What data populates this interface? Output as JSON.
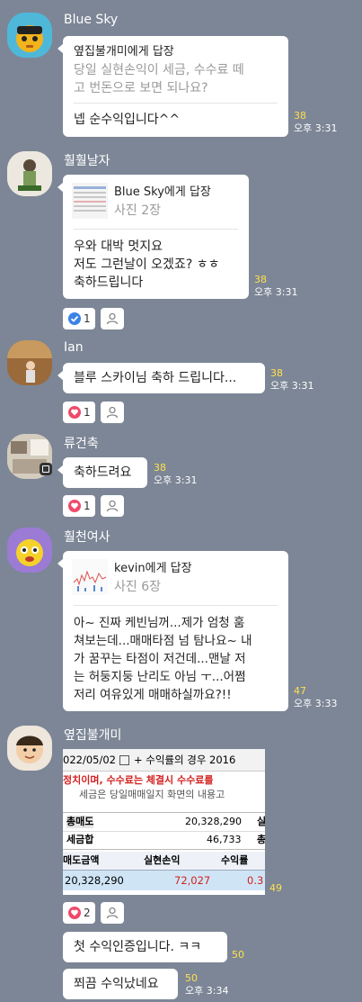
{
  "colors": {
    "background": "#7c8696",
    "bubble": "#ffffff",
    "unread": "#ffe14d"
  },
  "messages": [
    {
      "sender": "Blue Sky",
      "reply_to": "옆집불개미에게 답장",
      "quoted_line1": "당일 실현손익이 세금, 수수료 떼",
      "quoted_line2": "고 번돈으로 보면 되나요?",
      "text": "넵 순수익입니다^^",
      "unread": "38",
      "time": "오후 3:31"
    },
    {
      "sender": "훨훨날자",
      "reply_to": "Blue Sky에게 답장",
      "quoted": "사진 2장",
      "line1": "우와 대박 멋지요",
      "line2": "저도 그런날이 오겠죠? ㅎㅎ",
      "line3": "축하드립니다",
      "unread": "38",
      "time": "오후 3:31",
      "reaction_count": "1"
    },
    {
      "sender": "Ian",
      "text": "블루 스카이님 축하 드립니다...",
      "unread": "38",
      "time": "오후 3:31",
      "reaction_count": "1"
    },
    {
      "sender": "류건축",
      "text": "축하드려요",
      "unread": "38",
      "time": "오후 3:31",
      "reaction_count": "1"
    },
    {
      "sender": "훨천여사",
      "reply_to": "kevin에게 답장",
      "quoted": "사진 6장",
      "line1": "아~ 진짜 케빈님꺼...제가 엄청 훔",
      "line2": "쳐보는데...매매타점 넘 탐나요~ 내",
      "line3": "가 꿈꾸는 타점이 저건데...맨날 저",
      "line4": "는 허둥지둥 난리도 아님 ㅜ...어쩜",
      "line5": "저리 여유있게 매매하실까요?!!",
      "unread": "47",
      "time": "오후 3:33"
    },
    {
      "sender": "옆집불개미",
      "image": {
        "date": "022/05/02",
        "header_tail": "+ 수익률의 경우 2016",
        "red_line": "정치이며, 수수료는 체결시 수수료를",
        "gray_line": "세금은 당일매매일지 화면의 내용고",
        "row1_label": "총매도",
        "row1_value": "20,328,290",
        "row1_tail": "실",
        "row2_label": "세금합",
        "row2_value": "46,733",
        "row2_tail": "총",
        "col1": "매도금액",
        "col2": "실현손익",
        "col3": "수익률",
        "val1": "20,328,290",
        "val2": "72,027",
        "val3": "0.3"
      },
      "image_unread": "49",
      "reaction_count": "2",
      "text1": "첫 수익인증입니다. ㅋㅋ",
      "text1_unread": "50",
      "text2": "쬐끔 수익났네요",
      "text2_unread": "50",
      "time": "오후 3:34"
    }
  ]
}
